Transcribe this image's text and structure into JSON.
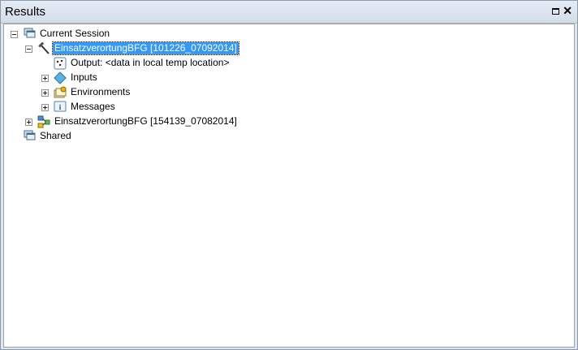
{
  "window": {
    "title": "Results"
  },
  "tree": {
    "current_session": "Current Session",
    "tool_run_1": "EinsatzverortungBFG [101226_07092014]",
    "output": "Output: <data in local temp location>",
    "inputs": "Inputs",
    "environments": "Environments",
    "messages": "Messages",
    "tool_run_2": "EinsatzverortungBFG [154139_07082014]",
    "shared": "Shared"
  },
  "colors": {
    "selection": "#3399ff",
    "titlebar": "#dfe6ef"
  }
}
